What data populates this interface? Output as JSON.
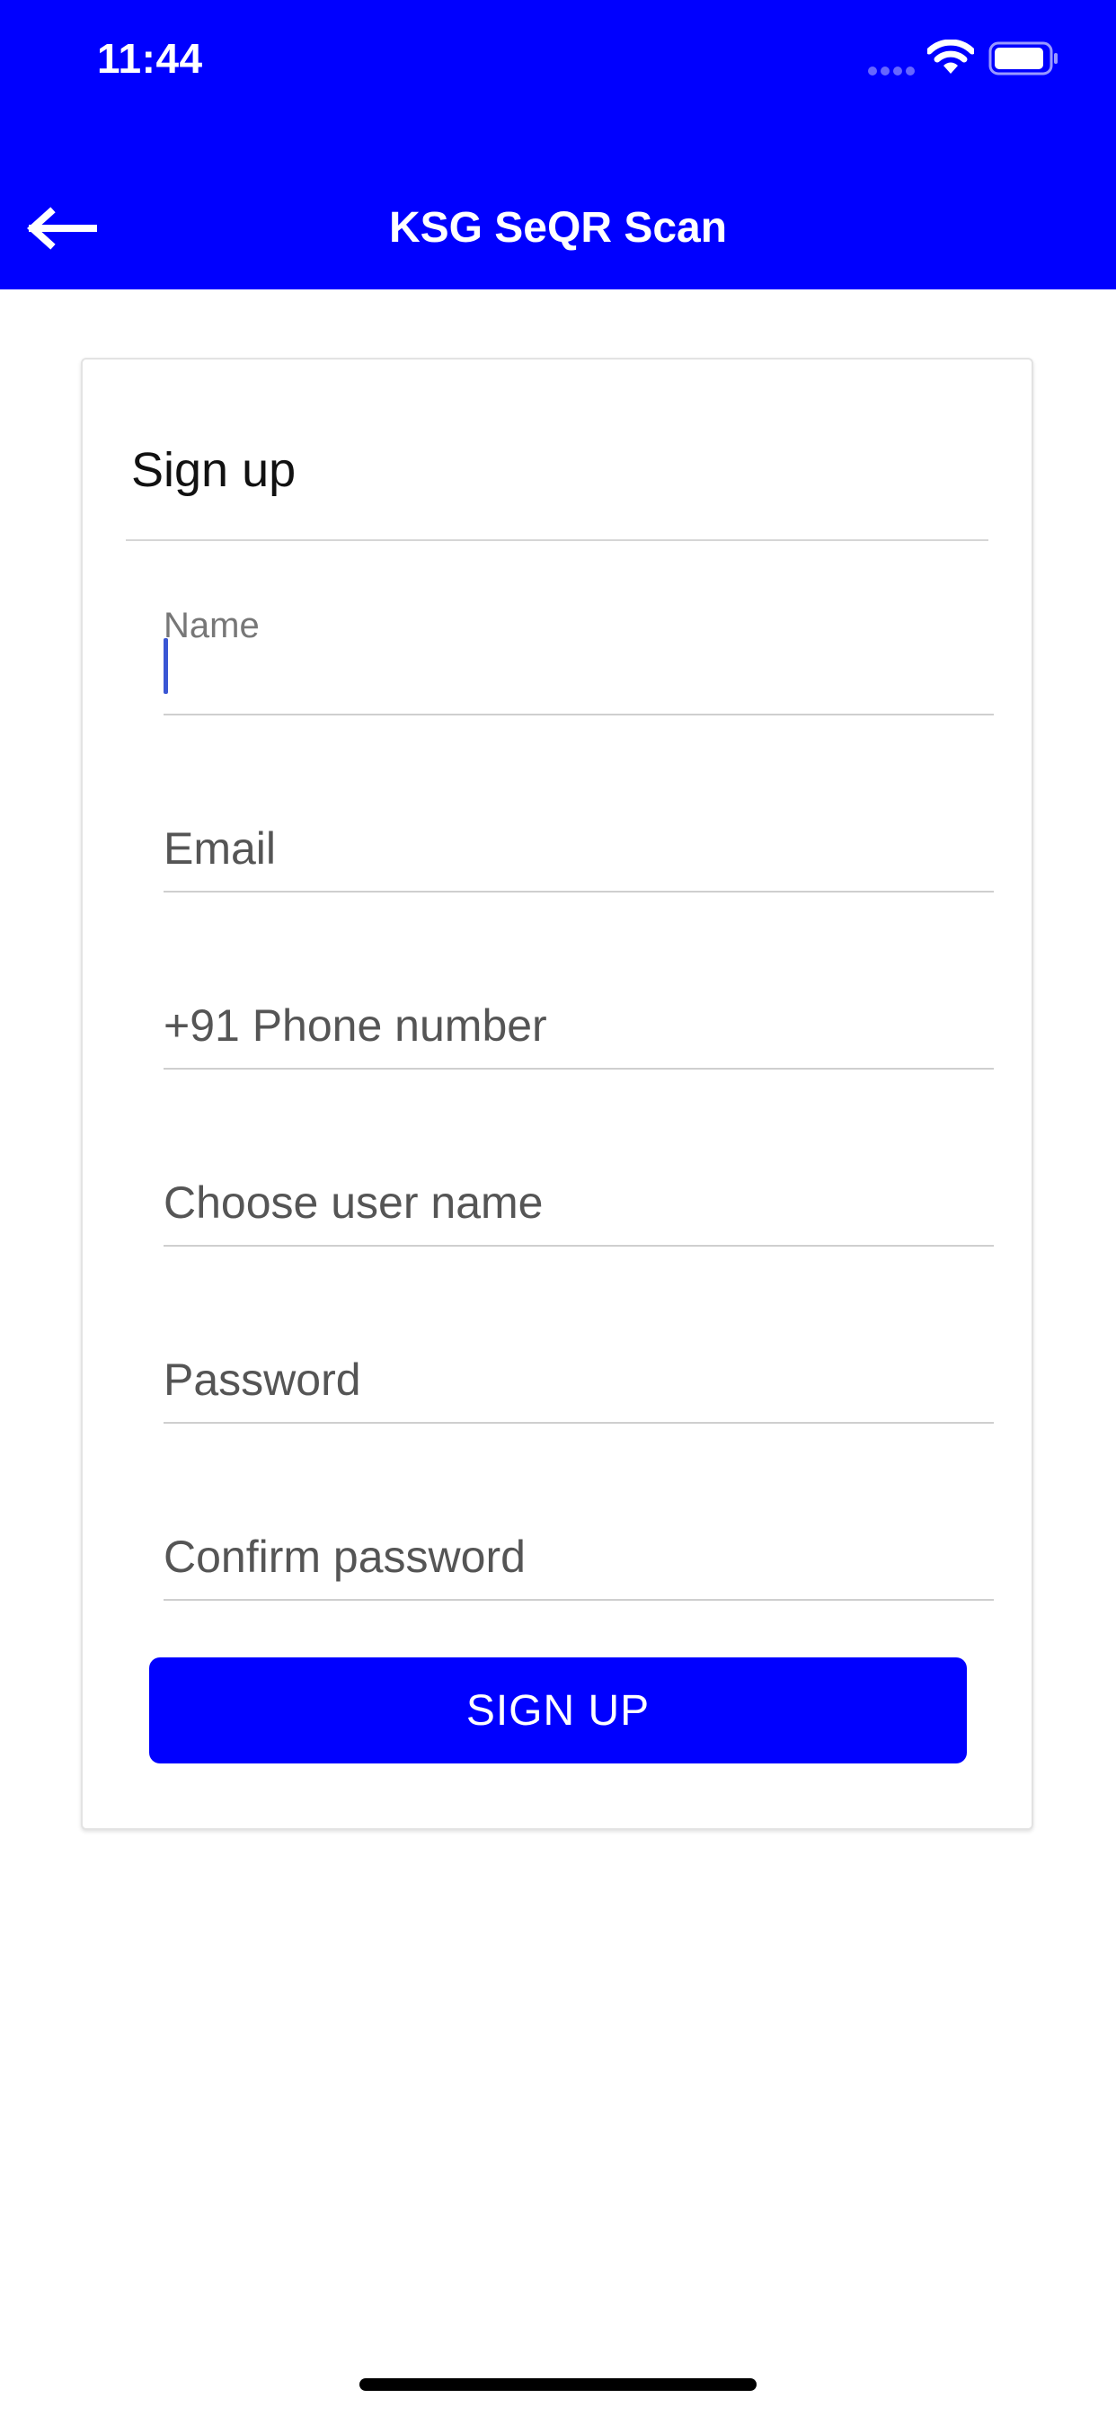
{
  "status_bar": {
    "time": "11:44",
    "icons": [
      "cellular-signal-icon",
      "wifi-icon",
      "battery-icon"
    ]
  },
  "nav": {
    "title": "KSG SeQR Scan",
    "back_icon": "arrow-left-icon"
  },
  "form": {
    "title": "Sign up",
    "fields": [
      {
        "label": "Name",
        "value": "",
        "focused": true
      },
      {
        "label": "Email",
        "value": ""
      },
      {
        "label": "+91 Phone number",
        "value": ""
      },
      {
        "label": "Choose user name",
        "value": ""
      },
      {
        "label": "Password",
        "value": ""
      },
      {
        "label": "Confirm password",
        "value": ""
      }
    ],
    "submit_label": "SIGN UP"
  },
  "colors": {
    "primary": "#0000ff",
    "caret": "#3a56d4",
    "background": "#ffffff"
  }
}
